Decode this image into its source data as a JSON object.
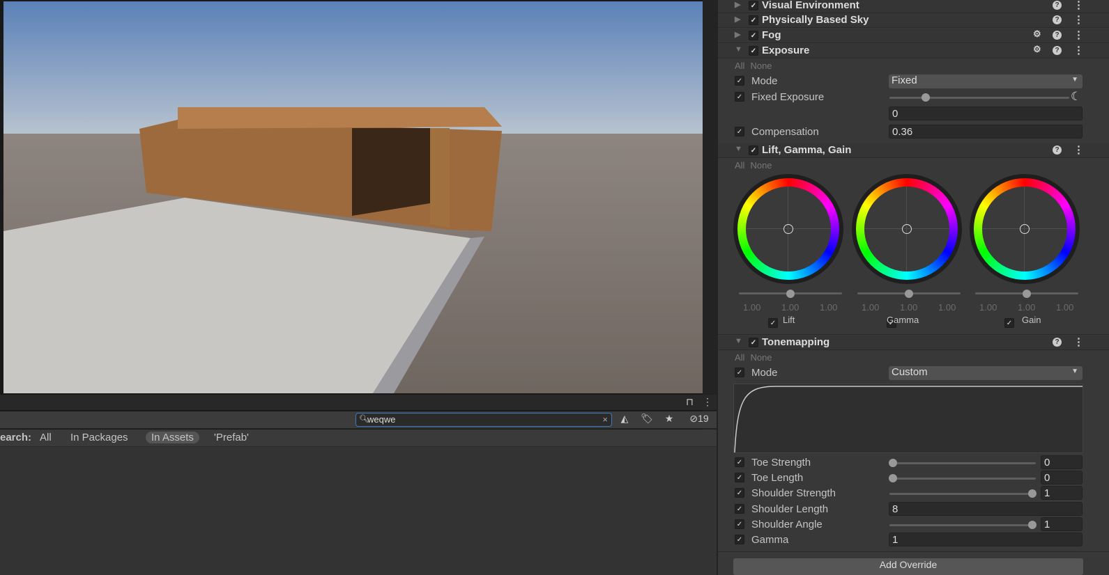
{
  "toolbar": {
    "lock_icon": "lock-icon",
    "more_icon": "kebab-icon"
  },
  "search": {
    "value": "weqwe",
    "clear": "×",
    "hidden_count": "19"
  },
  "scope": {
    "label": "earch:",
    "items": [
      "All",
      "In Packages",
      "In Assets",
      "'Prefab'"
    ],
    "selected": "In Assets"
  },
  "panel": {
    "sections": [
      {
        "title": "Visual Environment"
      },
      {
        "title": "Physically Based Sky"
      },
      {
        "title": "Fog"
      },
      {
        "title": "Exposure"
      },
      {
        "title": "Lift, Gamma, Gain"
      },
      {
        "title": "Tonemapping"
      }
    ],
    "all": "All",
    "none": "None",
    "check": "✓",
    "help": "?",
    "more": "⋮",
    "gear": "⚙",
    "exposure": {
      "mode_label": "Mode",
      "mode_value": "Fixed",
      "fixed_label": "Fixed Exposure",
      "fixed_value": "0",
      "fixed_slider": 0.2,
      "comp_label": "Compensation",
      "comp_value": "0.36"
    },
    "lgg": {
      "wheels": [
        {
          "label": "Lift",
          "values": [
            "1.00",
            "1.00",
            "1.00"
          ],
          "slider": 0.5
        },
        {
          "label": "Gamma",
          "values": [
            "1.00",
            "1.00",
            "1.00"
          ],
          "slider": 0.5
        },
        {
          "label": "Gain",
          "values": [
            "1.00",
            "1.00",
            "1.00"
          ],
          "slider": 0.5
        }
      ]
    },
    "tonemapping": {
      "mode_label": "Mode",
      "mode_value": "Custom",
      "rows": [
        {
          "label": "Toe Strength",
          "value": "0",
          "slider": 0
        },
        {
          "label": "Toe Length",
          "value": "0",
          "slider": 0
        },
        {
          "label": "Shoulder Strength",
          "value": "1",
          "slider": 1
        },
        {
          "label": "Shoulder Length",
          "value": "8"
        },
        {
          "label": "Shoulder Angle",
          "value": "1",
          "slider": 1
        },
        {
          "label": "Gamma",
          "value": "1"
        }
      ]
    },
    "add_override": "Add Override"
  }
}
